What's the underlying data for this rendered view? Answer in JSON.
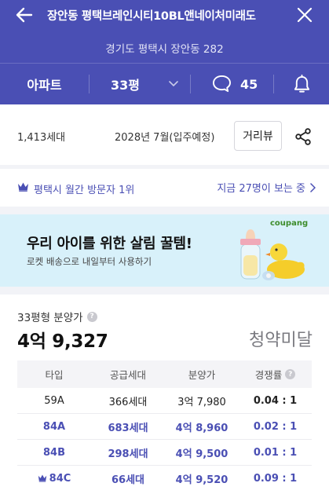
{
  "header": {
    "title": "장안동 평택브레인시티10BL앤네이처미래도",
    "address": "경기도 평택시 장안동 282",
    "type_label": "아파트",
    "size_label": "33평",
    "comment_count": "45"
  },
  "info": {
    "units": "1,413세대",
    "move_in": "2028년 7월(입주예정)",
    "street_view_label": "거리뷰"
  },
  "visitor": {
    "rank": "평택시 월간 방문자 1위",
    "viewing_now": "지금 27명이 보는 중"
  },
  "ad": {
    "title": "우리 아이를 위한 살림 꿀템!",
    "subtitle": "로켓 배송으로 내일부터 사용하기",
    "brand": "coupang"
  },
  "price": {
    "label": "33평형 분양가",
    "value": "4억 9,327",
    "status": "청약미달"
  },
  "table": {
    "headers": [
      "타입",
      "공급세대",
      "분양가",
      "경쟁률"
    ],
    "rows": [
      {
        "type": "59A",
        "supply": "366세대",
        "price": "3억 7,980",
        "rate": "0.04 : 1"
      },
      {
        "type": "84A",
        "supply": "683세대",
        "price": "4억 8,960",
        "rate": "0.02 : 1"
      },
      {
        "type": "84B",
        "supply": "298세대",
        "price": "4억 9,500",
        "rate": "0.01 : 1"
      },
      {
        "type": "84C",
        "supply": "66세대",
        "price": "4억 9,520",
        "rate": "0.09 : 1"
      }
    ]
  },
  "colors": {
    "brand": "#4a4fb4",
    "ad_background": "#d8f1fa",
    "status_gray": "#7a7a80"
  },
  "icons": [
    "back-arrow-icon",
    "close-icon",
    "chevron-down-icon",
    "comment-icon",
    "bell-icon",
    "share-icon",
    "crown-icon",
    "chevron-right-icon",
    "help-icon"
  ]
}
